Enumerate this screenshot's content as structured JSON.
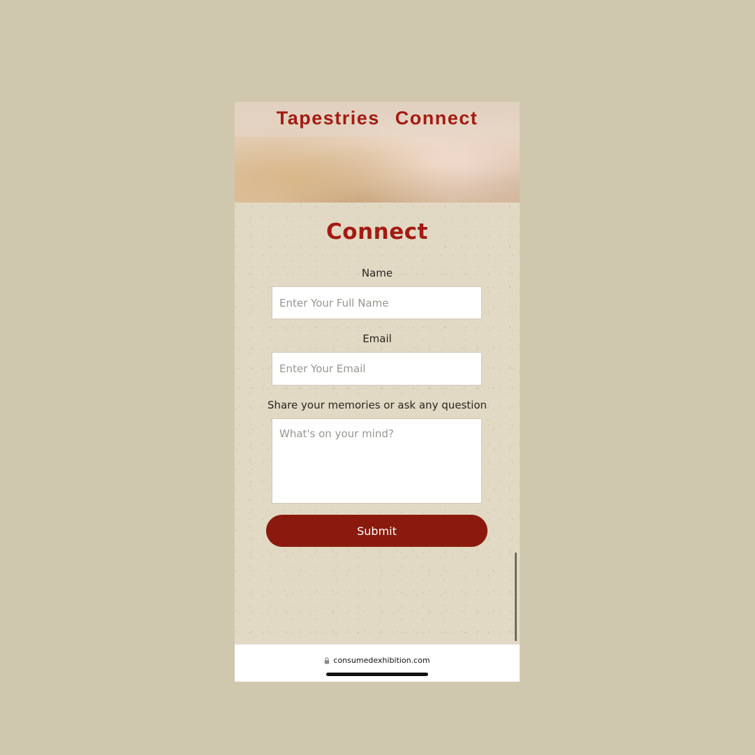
{
  "nav": {
    "items": [
      {
        "label": "Tapestries"
      },
      {
        "label": "Connect"
      }
    ]
  },
  "page": {
    "title": "Connect"
  },
  "form": {
    "name_label": "Name",
    "name_placeholder": "Enter Your Full Name",
    "name_value": "",
    "email_label": "Email",
    "email_placeholder": "Enter Your Email",
    "email_value": "",
    "message_label": "Share your memories or ask any question",
    "message_placeholder": "What's on your mind?",
    "message_value": "",
    "submit_label": "Submit"
  },
  "social": {
    "icons": [
      "facebook-icon",
      "instagram-icon"
    ]
  },
  "browser": {
    "url": "consumedexhibition.com",
    "lock_icon": "lock-icon"
  },
  "colors": {
    "background": "#d0c8ae",
    "accent": "#a31b12",
    "button": "#8a1a0d",
    "content_bg": "#e1d9c3"
  }
}
